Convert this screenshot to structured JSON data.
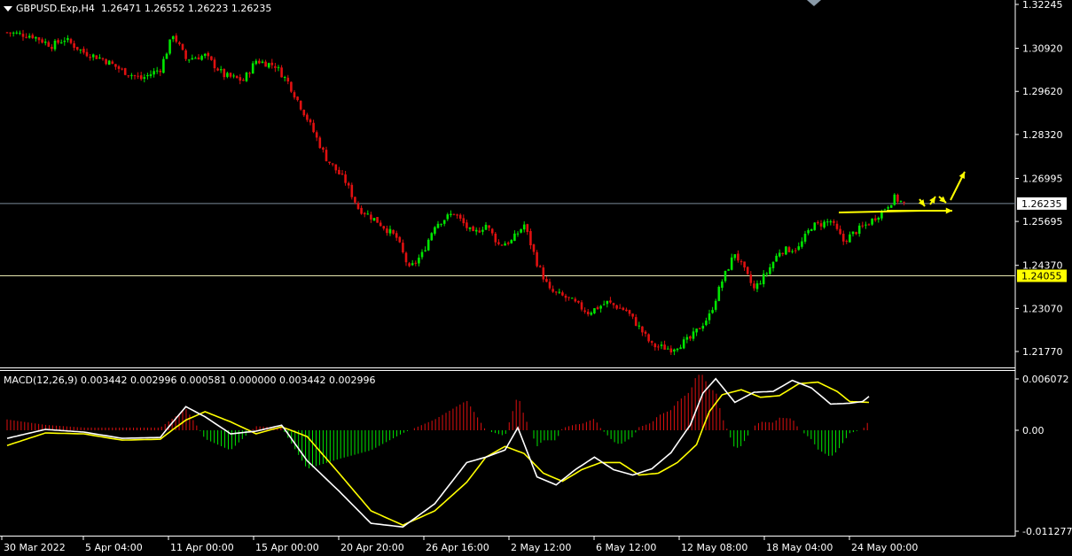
{
  "header": {
    "symbol": "GBPUSD.Exp,H4",
    "ohlc": "1.26471 1.26552 1.26223 1.26235"
  },
  "macd_header": "MACD(12,26,9) 0.003442 0.002996 0.000581 0.000000 0.003442 0.002996",
  "colors": {
    "background": "#000000",
    "bull": "#00e600",
    "bear": "#e01010",
    "axis": "#ffffff",
    "hline_current": "#7a8a99",
    "hline_level": "#e8e8b0",
    "level_badge": "#ffff00",
    "arrow": "#ffff00",
    "macd_line": "#ffffff",
    "signal_line": "#ffff00"
  },
  "price_axis": {
    "ticks": [
      "1.32245",
      "1.30920",
      "1.29620",
      "1.28320",
      "1.26995",
      "1.25695",
      "1.24370",
      "1.23070",
      "1.21770"
    ],
    "current_label": "1.26235",
    "level_label": "1.24055"
  },
  "macd_axis": {
    "ticks": [
      "0.006072",
      "0.00",
      "-0.011277"
    ]
  },
  "time_axis": {
    "labels": [
      "30 Mar 2022",
      "5 Apr 04:00",
      "11 Apr 00:00",
      "15 Apr 00:00",
      "20 Apr 20:00",
      "26 Apr 16:00",
      "2 May 12:00",
      "6 May 12:00",
      "12 May 08:00",
      "18 May 04:00",
      "24 May 00:00"
    ]
  },
  "chart_data": {
    "type": "candlestick",
    "symbol": "GBPUSD.Exp",
    "timeframe": "H4",
    "ylim": [
      1.2125,
      1.323
    ],
    "horizontal_lines": [
      {
        "value": 1.26235
      },
      {
        "value": 1.24055
      }
    ],
    "close_path": [
      [
        0,
        1.314
      ],
      [
        8,
        1.313
      ],
      [
        14,
        1.31
      ],
      [
        18,
        1.312
      ],
      [
        24,
        1.308
      ],
      [
        30,
        1.306
      ],
      [
        36,
        1.3025
      ],
      [
        42,
        1.3
      ],
      [
        48,
        1.303
      ],
      [
        52,
        1.3135
      ],
      [
        56,
        1.306
      ],
      [
        62,
        1.307
      ],
      [
        68,
        1.301
      ],
      [
        74,
        1.2995
      ],
      [
        78,
        1.3055
      ],
      [
        84,
        1.304
      ],
      [
        88,
        1.299
      ],
      [
        94,
        1.288
      ],
      [
        100,
        1.276
      ],
      [
        106,
        1.269
      ],
      [
        110,
        1.261
      ],
      [
        116,
        1.257
      ],
      [
        122,
        1.252
      ],
      [
        126,
        1.2425
      ],
      [
        130,
        1.247
      ],
      [
        134,
        1.256
      ],
      [
        140,
        1.2595
      ],
      [
        146,
        1.253
      ],
      [
        150,
        1.256
      ],
      [
        154,
        1.25
      ],
      [
        158,
        1.251
      ],
      [
        162,
        1.256
      ],
      [
        166,
        1.2445
      ],
      [
        170,
        1.236
      ],
      [
        176,
        1.2335
      ],
      [
        182,
        1.2295
      ],
      [
        188,
        1.2325
      ],
      [
        194,
        1.23
      ],
      [
        198,
        1.225
      ],
      [
        202,
        1.2195
      ],
      [
        208,
        1.2185
      ],
      [
        214,
        1.2215
      ],
      [
        220,
        1.2285
      ],
      [
        224,
        1.239
      ],
      [
        228,
        1.2475
      ],
      [
        234,
        1.2365
      ],
      [
        238,
        1.2415
      ],
      [
        242,
        1.248
      ],
      [
        248,
        1.249
      ],
      [
        252,
        1.2555
      ],
      [
        258,
        1.257
      ],
      [
        262,
        1.251
      ],
      [
        266,
        1.254
      ],
      [
        270,
        1.2565
      ],
      [
        274,
        1.26
      ],
      [
        278,
        1.264
      ],
      [
        281,
        1.2624
      ]
    ],
    "macd_series": [
      {
        "values_path": [
          [
            0,
            -0.0009
          ],
          [
            12,
            0.0001
          ],
          [
            24,
            -0.0002
          ],
          [
            36,
            -0.0009
          ],
          [
            48,
            -0.0008
          ],
          [
            56,
            0.0028
          ],
          [
            62,
            0.0016
          ],
          [
            70,
            -0.0004
          ],
          [
            78,
            -0.0001
          ],
          [
            86,
            0.0006
          ],
          [
            94,
            -0.0034
          ],
          [
            104,
            -0.0068
          ],
          [
            114,
            -0.0104
          ],
          [
            124,
            -0.0108
          ],
          [
            134,
            -0.0082
          ],
          [
            144,
            -0.0036
          ],
          [
            150,
            -0.003
          ],
          [
            156,
            -0.0022
          ],
          [
            160,
            0.0003
          ],
          [
            166,
            -0.0052
          ],
          [
            172,
            -0.0061
          ],
          [
            178,
            -0.0044
          ],
          [
            184,
            -0.003
          ],
          [
            190,
            -0.0044
          ],
          [
            196,
            -0.005
          ],
          [
            202,
            -0.0043
          ],
          [
            208,
            -0.0025
          ],
          [
            214,
            0.0006
          ],
          [
            218,
            0.0044
          ],
          [
            222,
            0.0061
          ],
          [
            228,
            0.0033
          ],
          [
            234,
            0.0045
          ],
          [
            240,
            0.0046
          ],
          [
            246,
            0.0059
          ],
          [
            252,
            0.005
          ],
          [
            258,
            0.0031
          ],
          [
            264,
            0.0032
          ],
          [
            268,
            0.0034
          ],
          [
            270,
            0.004
          ]
        ]
      },
      {
        "values_path": [
          [
            0,
            -0.0017
          ],
          [
            12,
            -0.0003
          ],
          [
            24,
            -0.0004
          ],
          [
            36,
            -0.0011
          ],
          [
            48,
            -0.001
          ],
          [
            56,
            0.0012
          ],
          [
            62,
            0.0022
          ],
          [
            70,
            0.001
          ],
          [
            78,
            -0.0004
          ],
          [
            86,
            0.0004
          ],
          [
            94,
            -0.0007
          ],
          [
            104,
            -0.0048
          ],
          [
            114,
            -0.009
          ],
          [
            124,
            -0.0106
          ],
          [
            134,
            -0.009
          ],
          [
            144,
            -0.0058
          ],
          [
            150,
            -0.003
          ],
          [
            156,
            -0.0018
          ],
          [
            162,
            -0.0026
          ],
          [
            168,
            -0.0048
          ],
          [
            174,
            -0.0057
          ],
          [
            180,
            -0.0044
          ],
          [
            186,
            -0.0036
          ],
          [
            192,
            -0.0036
          ],
          [
            198,
            -0.005
          ],
          [
            204,
            -0.0048
          ],
          [
            210,
            -0.0036
          ],
          [
            216,
            -0.0016
          ],
          [
            220,
            0.0022
          ],
          [
            224,
            0.0042
          ],
          [
            230,
            0.0048
          ],
          [
            236,
            0.0039
          ],
          [
            242,
            0.0041
          ],
          [
            248,
            0.0055
          ],
          [
            254,
            0.0057
          ],
          [
            260,
            0.0046
          ],
          [
            264,
            0.0034
          ],
          [
            270,
            0.0033
          ]
        ]
      }
    ]
  }
}
